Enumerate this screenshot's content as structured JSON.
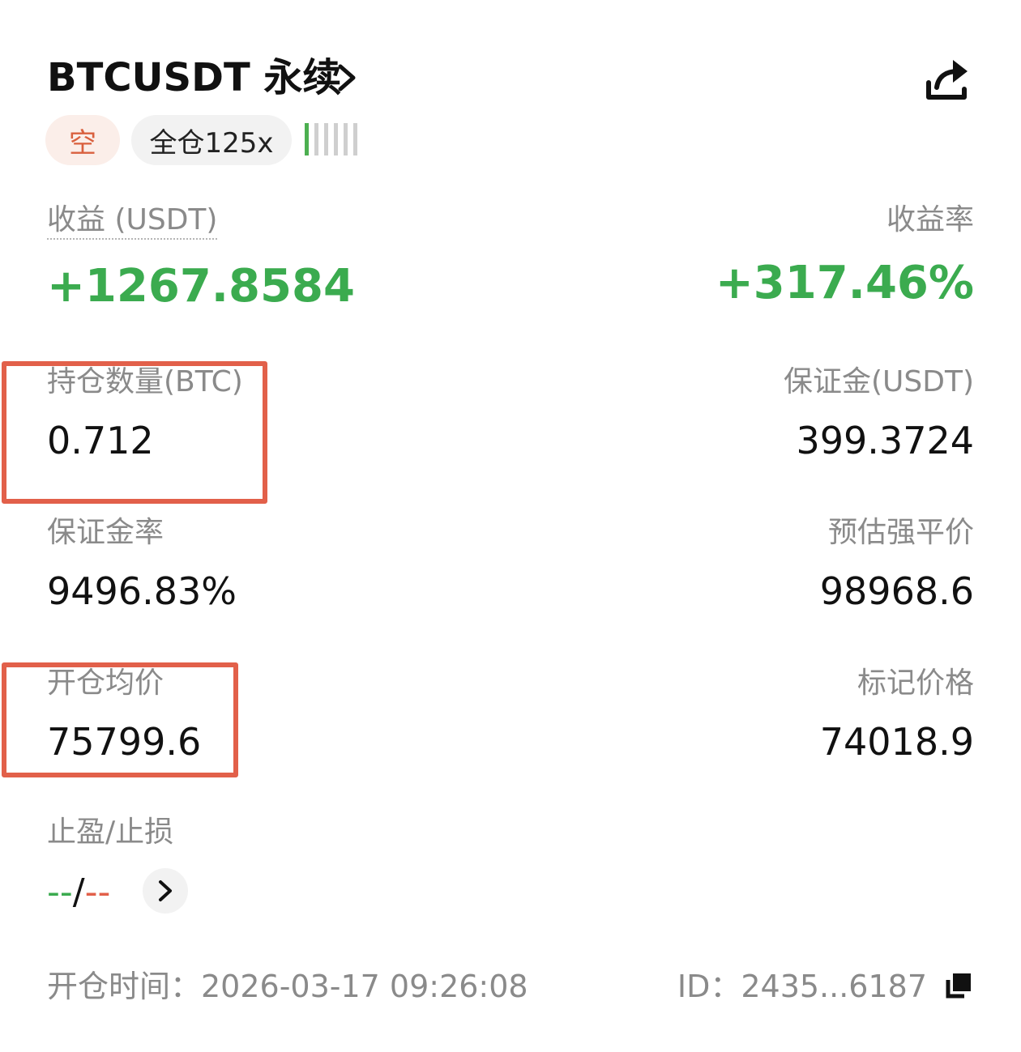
{
  "header": {
    "title": "BTCUSDT 永续",
    "chevron_icon": "chevron-right-icon",
    "share_icon": "share-icon"
  },
  "tags": {
    "side": "空",
    "leverage": "全仓125x"
  },
  "pnl": {
    "label": "收益 (USDT)",
    "value": "+1267.8584",
    "rate_label": "收益率",
    "rate_value": "+317.46%"
  },
  "position": {
    "size_label": "持仓数量(BTC)",
    "size_value": "0.712",
    "margin_label": "保证金(USDT)",
    "margin_value": "399.3724",
    "margin_ratio_label": "保证金率",
    "margin_ratio_value": "9496.83%",
    "liq_price_label": "预估强平价",
    "liq_price_value": "98968.6",
    "entry_price_label": "开仓均价",
    "entry_price_value": "75799.6",
    "mark_price_label": "标记价格",
    "mark_price_value": "74018.9"
  },
  "tpsl": {
    "label": "止盈/止损",
    "tp_value": "--",
    "separator": "/",
    "sl_value": "--"
  },
  "footer": {
    "open_time": "开仓时间：2026-03-17 09:26:08",
    "id": "ID：2435...6187",
    "copy_icon": "copy-icon"
  },
  "colors": {
    "profit_green": "#3bab4f",
    "short_red": "#d9603e",
    "highlight_red": "#e2604a",
    "label_gray": "#8a8a8a"
  }
}
